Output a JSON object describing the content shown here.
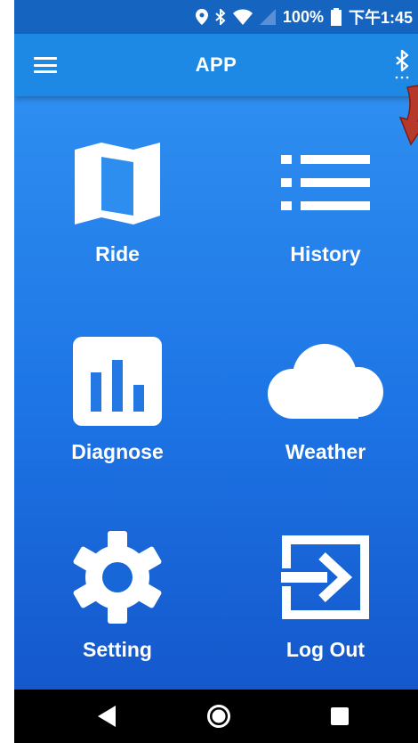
{
  "status_bar": {
    "battery": "100%",
    "time": "下午1:45",
    "icons": [
      "location-icon",
      "bluetooth-icon",
      "wifi-icon",
      "no-sim-icon",
      "battery-icon"
    ]
  },
  "app_bar": {
    "title": "APP",
    "left_icon": "menu-icon",
    "right_icon": "bluetooth-icon"
  },
  "grid": {
    "items": [
      {
        "label": "Ride",
        "icon": "map-icon"
      },
      {
        "label": "History",
        "icon": "list-icon"
      },
      {
        "label": "Diagnose",
        "icon": "bar-chart-icon"
      },
      {
        "label": "Weather",
        "icon": "cloud-icon"
      },
      {
        "label": "Setting",
        "icon": "gear-icon"
      },
      {
        "label": "Log Out",
        "icon": "logout-icon"
      }
    ]
  },
  "nav_bar": {
    "buttons": [
      "back-icon",
      "home-icon",
      "recents-icon"
    ]
  },
  "colors": {
    "status_bar": "#1565c0",
    "app_bar": "#1e88e5",
    "background_top": "#2e8ef0",
    "background_bottom": "#1458cc",
    "annotation_arrow": "#b5382a"
  }
}
